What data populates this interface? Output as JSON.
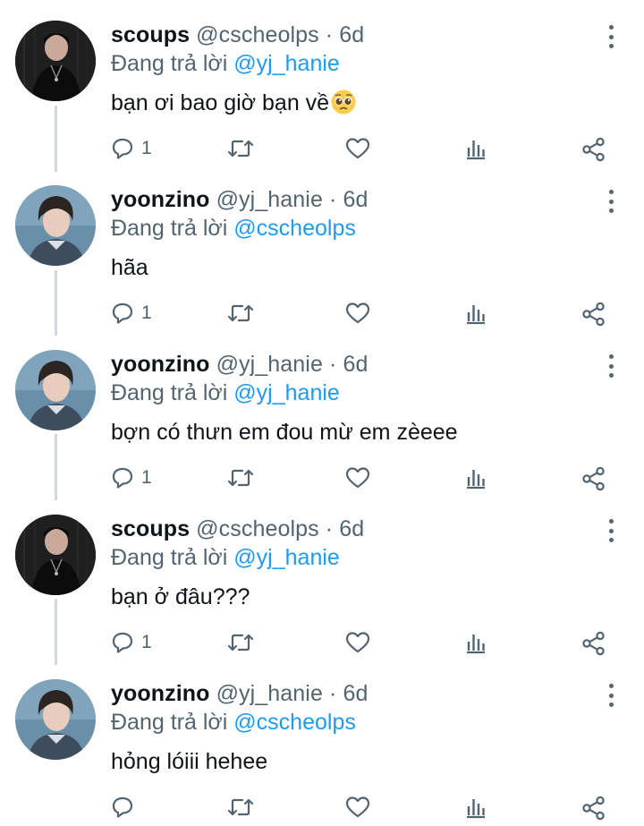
{
  "tweets": [
    {
      "name": "scoups",
      "handle": "@cscheolps",
      "time": "6d",
      "replying_prefix": "Đang trả lời",
      "replying_to": "@yj_hanie",
      "text": "bạn ơi bao giờ bạn về",
      "emoji": "pleading-face-emoji",
      "reply_count": "1",
      "avatar": "scoups-avatar"
    },
    {
      "name": "yoonzino",
      "handle": "@yj_hanie",
      "time": "6d",
      "replying_prefix": "Đang trả lời",
      "replying_to": "@cscheolps",
      "text": "hãa",
      "reply_count": "1",
      "avatar": "yoonzino-avatar"
    },
    {
      "name": "yoonzino",
      "handle": "@yj_hanie",
      "time": "6d",
      "replying_prefix": "Đang trả lời",
      "replying_to": "@yj_hanie",
      "text": "bợn có thưn em đou mừ em zèeee",
      "reply_count": "1",
      "avatar": "yoonzino-avatar"
    },
    {
      "name": "scoups",
      "handle": "@cscheolps",
      "time": "6d",
      "replying_prefix": "Đang trả lời",
      "replying_to": "@yj_hanie",
      "text": "bạn ở đâu???",
      "reply_count": "1",
      "avatar": "scoups-avatar"
    },
    {
      "name": "yoonzino",
      "handle": "@yj_hanie",
      "time": "6d",
      "replying_prefix": "Đang trả lời",
      "replying_to": "@cscheolps",
      "text": "hỏng lóiii hehee",
      "reply_count": "",
      "avatar": "yoonzino-avatar"
    }
  ],
  "icons": {
    "reply": "reply-icon",
    "retweet": "retweet-icon",
    "like": "heart-icon",
    "analytics": "analytics-icon",
    "share": "share-icon",
    "more": "more-vertical-icon"
  },
  "colors": {
    "text": "#0f1419",
    "secondary": "#536471",
    "link": "#1d9bf0",
    "thread_line": "#cfd9de"
  }
}
